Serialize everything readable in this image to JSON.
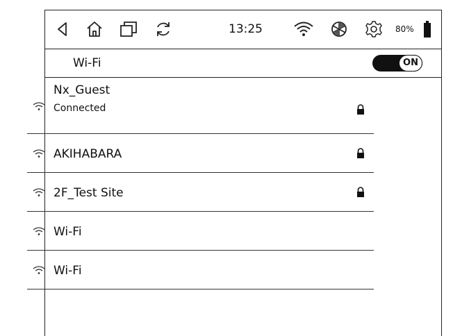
{
  "status_bar": {
    "time": "13:25",
    "battery": "80%",
    "icons": [
      "back-icon",
      "home-icon",
      "window-icon",
      "refresh-icon",
      "wifi-signal-icon",
      "aperture-icon",
      "gear-icon",
      "battery-icon"
    ]
  },
  "header": {
    "title": "Wi-Fi",
    "toggle_label": "ON",
    "toggle_on": true
  },
  "networks": [
    {
      "name": "Nx_Guest",
      "status": "Connected",
      "locked": true
    },
    {
      "name": "AKIHABARA",
      "status": "",
      "locked": true
    },
    {
      "name": "2F_Test Site",
      "status": "",
      "locked": true
    },
    {
      "name": "Wi-Fi",
      "status": "",
      "locked": false
    },
    {
      "name": "Wi-Fi",
      "status": "",
      "locked": false
    }
  ]
}
